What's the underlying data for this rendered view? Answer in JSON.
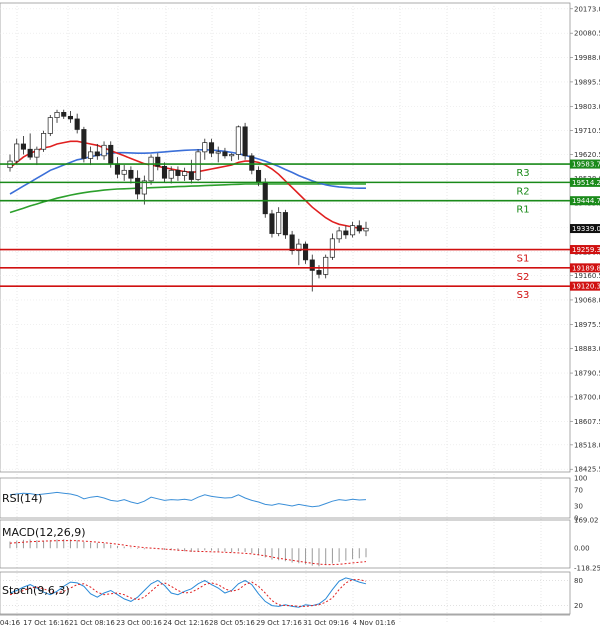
{
  "chart_data": {
    "type": "candlestick",
    "main": {
      "y_ticks": [
        20173.0,
        20080.5,
        19988.0,
        19895.5,
        19803.0,
        19710.5,
        19620.5,
        19528.0,
        19435.5,
        19343.0,
        19250.5,
        19160.5,
        19068.0,
        18975.5,
        18883.0,
        18790.5,
        18700.0,
        18607.5,
        18518.0,
        18425.5
      ],
      "y_tick_labels": [
        "20173.0",
        "20080.5",
        "19988.0",
        "19895.5",
        "19803.0",
        "19710.5",
        "19620.5",
        "19528.0",
        "19435.5",
        "19343.0",
        "19250.5",
        "19160.5",
        "19068.0",
        "18975.5",
        "18883.0",
        "18790.5",
        "18700.0",
        "18607.5",
        "18518.0",
        "18425.5"
      ],
      "ylim": [
        18415,
        20195
      ],
      "current_price": {
        "value": 19339.0,
        "label": "19339.0"
      },
      "levels": [
        {
          "name": "R3",
          "value": 19583.7,
          "label": "19583.7",
          "color": "#1a8a1a"
        },
        {
          "name": "R2",
          "value": 19514.2,
          "label": "19514.2",
          "color": "#1a8a1a"
        },
        {
          "name": "R1",
          "value": 19444.7,
          "label": "19444.7",
          "color": "#1a8a1a"
        },
        {
          "name": "S1",
          "value": 19259.3,
          "label": "19259.3",
          "color": "#d01010"
        },
        {
          "name": "S2",
          "value": 19189.8,
          "label": "19189.8",
          "color": "#d01010"
        },
        {
          "name": "S3",
          "value": 19120.3,
          "label": "19120.3",
          "color": "#d01010"
        }
      ],
      "candles": [
        {
          "o": 19570,
          "h": 19620,
          "l": 19555,
          "c": 19595
        },
        {
          "o": 19595,
          "h": 19680,
          "l": 19585,
          "c": 19660
        },
        {
          "o": 19660,
          "h": 19690,
          "l": 19620,
          "c": 19640
        },
        {
          "o": 19640,
          "h": 19700,
          "l": 19600,
          "c": 19610
        },
        {
          "o": 19610,
          "h": 19650,
          "l": 19580,
          "c": 19640
        },
        {
          "o": 19640,
          "h": 19710,
          "l": 19630,
          "c": 19700
        },
        {
          "o": 19700,
          "h": 19770,
          "l": 19690,
          "c": 19760
        },
        {
          "o": 19760,
          "h": 19790,
          "l": 19740,
          "c": 19780
        },
        {
          "o": 19780,
          "h": 19790,
          "l": 19755,
          "c": 19765
        },
        {
          "o": 19765,
          "h": 19785,
          "l": 19740,
          "c": 19755
        },
        {
          "o": 19755,
          "h": 19775,
          "l": 19700,
          "c": 19715
        },
        {
          "o": 19715,
          "h": 19725,
          "l": 19590,
          "c": 19605
        },
        {
          "o": 19605,
          "h": 19650,
          "l": 19580,
          "c": 19630
        },
        {
          "o": 19630,
          "h": 19660,
          "l": 19600,
          "c": 19615
        },
        {
          "o": 19615,
          "h": 19670,
          "l": 19600,
          "c": 19655
        },
        {
          "o": 19655,
          "h": 19670,
          "l": 19570,
          "c": 19585
        },
        {
          "o": 19585,
          "h": 19610,
          "l": 19530,
          "c": 19545
        },
        {
          "o": 19545,
          "h": 19580,
          "l": 19520,
          "c": 19560
        },
        {
          "o": 19560,
          "h": 19575,
          "l": 19510,
          "c": 19530
        },
        {
          "o": 19530,
          "h": 19560,
          "l": 19450,
          "c": 19470
        },
        {
          "o": 19470,
          "h": 19540,
          "l": 19430,
          "c": 19520
        },
        {
          "o": 19520,
          "h": 19620,
          "l": 19505,
          "c": 19610
        },
        {
          "o": 19610,
          "h": 19625,
          "l": 19560,
          "c": 19575
        },
        {
          "o": 19575,
          "h": 19590,
          "l": 19515,
          "c": 19530
        },
        {
          "o": 19530,
          "h": 19575,
          "l": 19510,
          "c": 19560
        },
        {
          "o": 19560,
          "h": 19575,
          "l": 19520,
          "c": 19540
        },
        {
          "o": 19540,
          "h": 19570,
          "l": 19520,
          "c": 19555
        },
        {
          "o": 19555,
          "h": 19600,
          "l": 19510,
          "c": 19525
        },
        {
          "o": 19525,
          "h": 19640,
          "l": 19520,
          "c": 19630
        },
        {
          "o": 19630,
          "h": 19680,
          "l": 19600,
          "c": 19665
        },
        {
          "o": 19665,
          "h": 19680,
          "l": 19610,
          "c": 19625
        },
        {
          "o": 19625,
          "h": 19650,
          "l": 19590,
          "c": 19630
        },
        {
          "o": 19630,
          "h": 19645,
          "l": 19605,
          "c": 19615
        },
        {
          "o": 19615,
          "h": 19625,
          "l": 19595,
          "c": 19620
        },
        {
          "o": 19620,
          "h": 19730,
          "l": 19600,
          "c": 19725
        },
        {
          "o": 19725,
          "h": 19740,
          "l": 19600,
          "c": 19615
        },
        {
          "o": 19615,
          "h": 19625,
          "l": 19545,
          "c": 19560
        },
        {
          "o": 19560,
          "h": 19575,
          "l": 19500,
          "c": 19515
        },
        {
          "o": 19515,
          "h": 19530,
          "l": 19380,
          "c": 19395
        },
        {
          "o": 19395,
          "h": 19410,
          "l": 19305,
          "c": 19320
        },
        {
          "o": 19320,
          "h": 19420,
          "l": 19310,
          "c": 19400
        },
        {
          "o": 19400,
          "h": 19410,
          "l": 19300,
          "c": 19315
        },
        {
          "o": 19315,
          "h": 19330,
          "l": 19240,
          "c": 19255
        },
        {
          "o": 19255,
          "h": 19300,
          "l": 19200,
          "c": 19280
        },
        {
          "o": 19280,
          "h": 19290,
          "l": 19205,
          "c": 19220
        },
        {
          "o": 19220,
          "h": 19240,
          "l": 19100,
          "c": 19180
        },
        {
          "o": 19180,
          "h": 19200,
          "l": 19150,
          "c": 19165
        },
        {
          "o": 19165,
          "h": 19240,
          "l": 19150,
          "c": 19230
        },
        {
          "o": 19230,
          "h": 19320,
          "l": 19220,
          "c": 19300
        },
        {
          "o": 19300,
          "h": 19345,
          "l": 19285,
          "c": 19330
        },
        {
          "o": 19330,
          "h": 19350,
          "l": 19300,
          "c": 19315
        },
        {
          "o": 19315,
          "h": 19365,
          "l": 19305,
          "c": 19350
        },
        {
          "o": 19350,
          "h": 19370,
          "l": 19320,
          "c": 19330
        },
        {
          "o": 19330,
          "h": 19365,
          "l": 19310,
          "c": 19340
        }
      ],
      "ma_fast": [
        19570,
        19590,
        19610,
        19625,
        19635,
        19645,
        19650,
        19660,
        19665,
        19670,
        19670,
        19665,
        19660,
        19655,
        19645,
        19635,
        19625,
        19615,
        19605,
        19595,
        19585,
        19580,
        19575,
        19570,
        19565,
        19560,
        19555,
        19552,
        19555,
        19560,
        19565,
        19570,
        19575,
        19580,
        19590,
        19595,
        19595,
        19590,
        19580,
        19565,
        19545,
        19520,
        19495,
        19470,
        19445,
        19420,
        19400,
        19380,
        19365,
        19355,
        19350,
        19345,
        19340,
        19338
      ],
      "ma_mid": [
        19470,
        19485,
        19500,
        19515,
        19530,
        19545,
        19560,
        19570,
        19580,
        19590,
        19600,
        19605,
        19612,
        19617,
        19622,
        19625,
        19627,
        19627,
        19626,
        19625,
        19625,
        19626,
        19628,
        19630,
        19632,
        19634,
        19636,
        19637,
        19638,
        19638,
        19637,
        19635,
        19632,
        19628,
        19623,
        19617,
        19610,
        19603,
        19595,
        19585,
        19575,
        19563,
        19552,
        19540,
        19530,
        19520,
        19512,
        19505,
        19500,
        19497,
        19495,
        19493,
        19492,
        19492
      ],
      "ma_slow": [
        19400,
        19408,
        19416,
        19425,
        19432,
        19440,
        19447,
        19454,
        19460,
        19466,
        19471,
        19475,
        19479,
        19482,
        19485,
        19487,
        19489,
        19490,
        19491,
        19492,
        19493,
        19494,
        19495,
        19496,
        19497,
        19498,
        19499,
        19500,
        19501,
        19502,
        19503,
        19504,
        19505,
        19506,
        19507,
        19508,
        19508,
        19508,
        19508,
        19508,
        19508,
        19508,
        19508,
        19508,
        19508,
        19508,
        19508,
        19508,
        19508,
        19508,
        19508,
        19508,
        19508,
        19508
      ]
    },
    "rsi": {
      "title": "RSI(14)",
      "ticks": [
        {
          "value": 100,
          "label": "100"
        },
        {
          "value": 70,
          "label": "70"
        },
        {
          "value": 30,
          "label": "30"
        },
        {
          "value": 0,
          "label": "0"
        }
      ],
      "ylim": [
        0,
        100
      ],
      "values": [
        58,
        60,
        62,
        61,
        58,
        60,
        62,
        64,
        62,
        60,
        56,
        48,
        52,
        54,
        50,
        44,
        42,
        46,
        40,
        36,
        42,
        52,
        48,
        44,
        46,
        45,
        47,
        44,
        52,
        58,
        54,
        52,
        50,
        51,
        58,
        50,
        44,
        40,
        34,
        32,
        36,
        33,
        30,
        34,
        31,
        28,
        30,
        36,
        42,
        46,
        44,
        47,
        45,
        46
      ]
    },
    "macd": {
      "title": "MACD(12,26,9)",
      "ticks": [
        {
          "value": 169.02,
          "label": "169.02"
        },
        {
          "value": 0.0,
          "label": "0.00"
        },
        {
          "value": -118.25,
          "label": "-118.25"
        }
      ],
      "ylim": [
        -118.25,
        169.02
      ],
      "histogram": [
        40,
        45,
        50,
        52,
        48,
        46,
        48,
        52,
        54,
        52,
        48,
        38,
        34,
        32,
        30,
        22,
        14,
        10,
        4,
        -4,
        -6,
        -2,
        -4,
        -10,
        -12,
        -16,
        -18,
        -22,
        -18,
        -12,
        -14,
        -18,
        -20,
        -24,
        -18,
        -22,
        -30,
        -38,
        -55,
        -68,
        -72,
        -78,
        -86,
        -90,
        -96,
        -104,
        -108,
        -100,
        -92,
        -82,
        -74,
        -66,
        -60,
        -54
      ],
      "signal": [
        30,
        33,
        36,
        39,
        41,
        43,
        44,
        45,
        46,
        46,
        45,
        43,
        40,
        37,
        33,
        29,
        24,
        19,
        13,
        8,
        4,
        1,
        -2,
        -5,
        -8,
        -11,
        -14,
        -17,
        -19,
        -20,
        -21,
        -22,
        -24,
        -26,
        -28,
        -30,
        -34,
        -39,
        -45,
        -53,
        -60,
        -66,
        -72,
        -78,
        -84,
        -90,
        -95,
        -98,
        -98,
        -96,
        -92,
        -88,
        -84,
        -80
      ]
    },
    "stoch": {
      "title": "Stoch(9,6,3)",
      "ticks": [
        {
          "value": 80,
          "label": "80"
        },
        {
          "value": 20,
          "label": "20"
        }
      ],
      "ylim": [
        0,
        100
      ],
      "k": [
        50,
        56,
        64,
        70,
        62,
        52,
        46,
        54,
        66,
        76,
        74,
        66,
        48,
        40,
        50,
        56,
        46,
        36,
        30,
        40,
        56,
        72,
        80,
        68,
        50,
        46,
        54,
        60,
        72,
        80,
        70,
        62,
        50,
        56,
        72,
        80,
        70,
        48,
        30,
        20,
        18,
        22,
        18,
        16,
        22,
        20,
        24,
        36,
        58,
        78,
        86,
        82,
        76,
        72
      ],
      "d": [
        46,
        50,
        56,
        62,
        64,
        60,
        54,
        50,
        54,
        62,
        70,
        72,
        64,
        52,
        46,
        48,
        50,
        46,
        38,
        34,
        40,
        54,
        68,
        74,
        66,
        56,
        50,
        52,
        60,
        70,
        74,
        70,
        60,
        54,
        58,
        70,
        76,
        66,
        50,
        32,
        22,
        20,
        20,
        18,
        18,
        20,
        22,
        28,
        38,
        58,
        74,
        82,
        82,
        78
      ]
    },
    "x_tick_labels": [
      "04:16",
      "17 Oct 16:16",
      "21 Oct 08:16",
      "23 Oct 00:16",
      "24 Oct 12:16",
      "28 Oct 05:16",
      "29 Oct 17:16",
      "31 Oct 09:16",
      "4 Nov 01:16"
    ]
  }
}
